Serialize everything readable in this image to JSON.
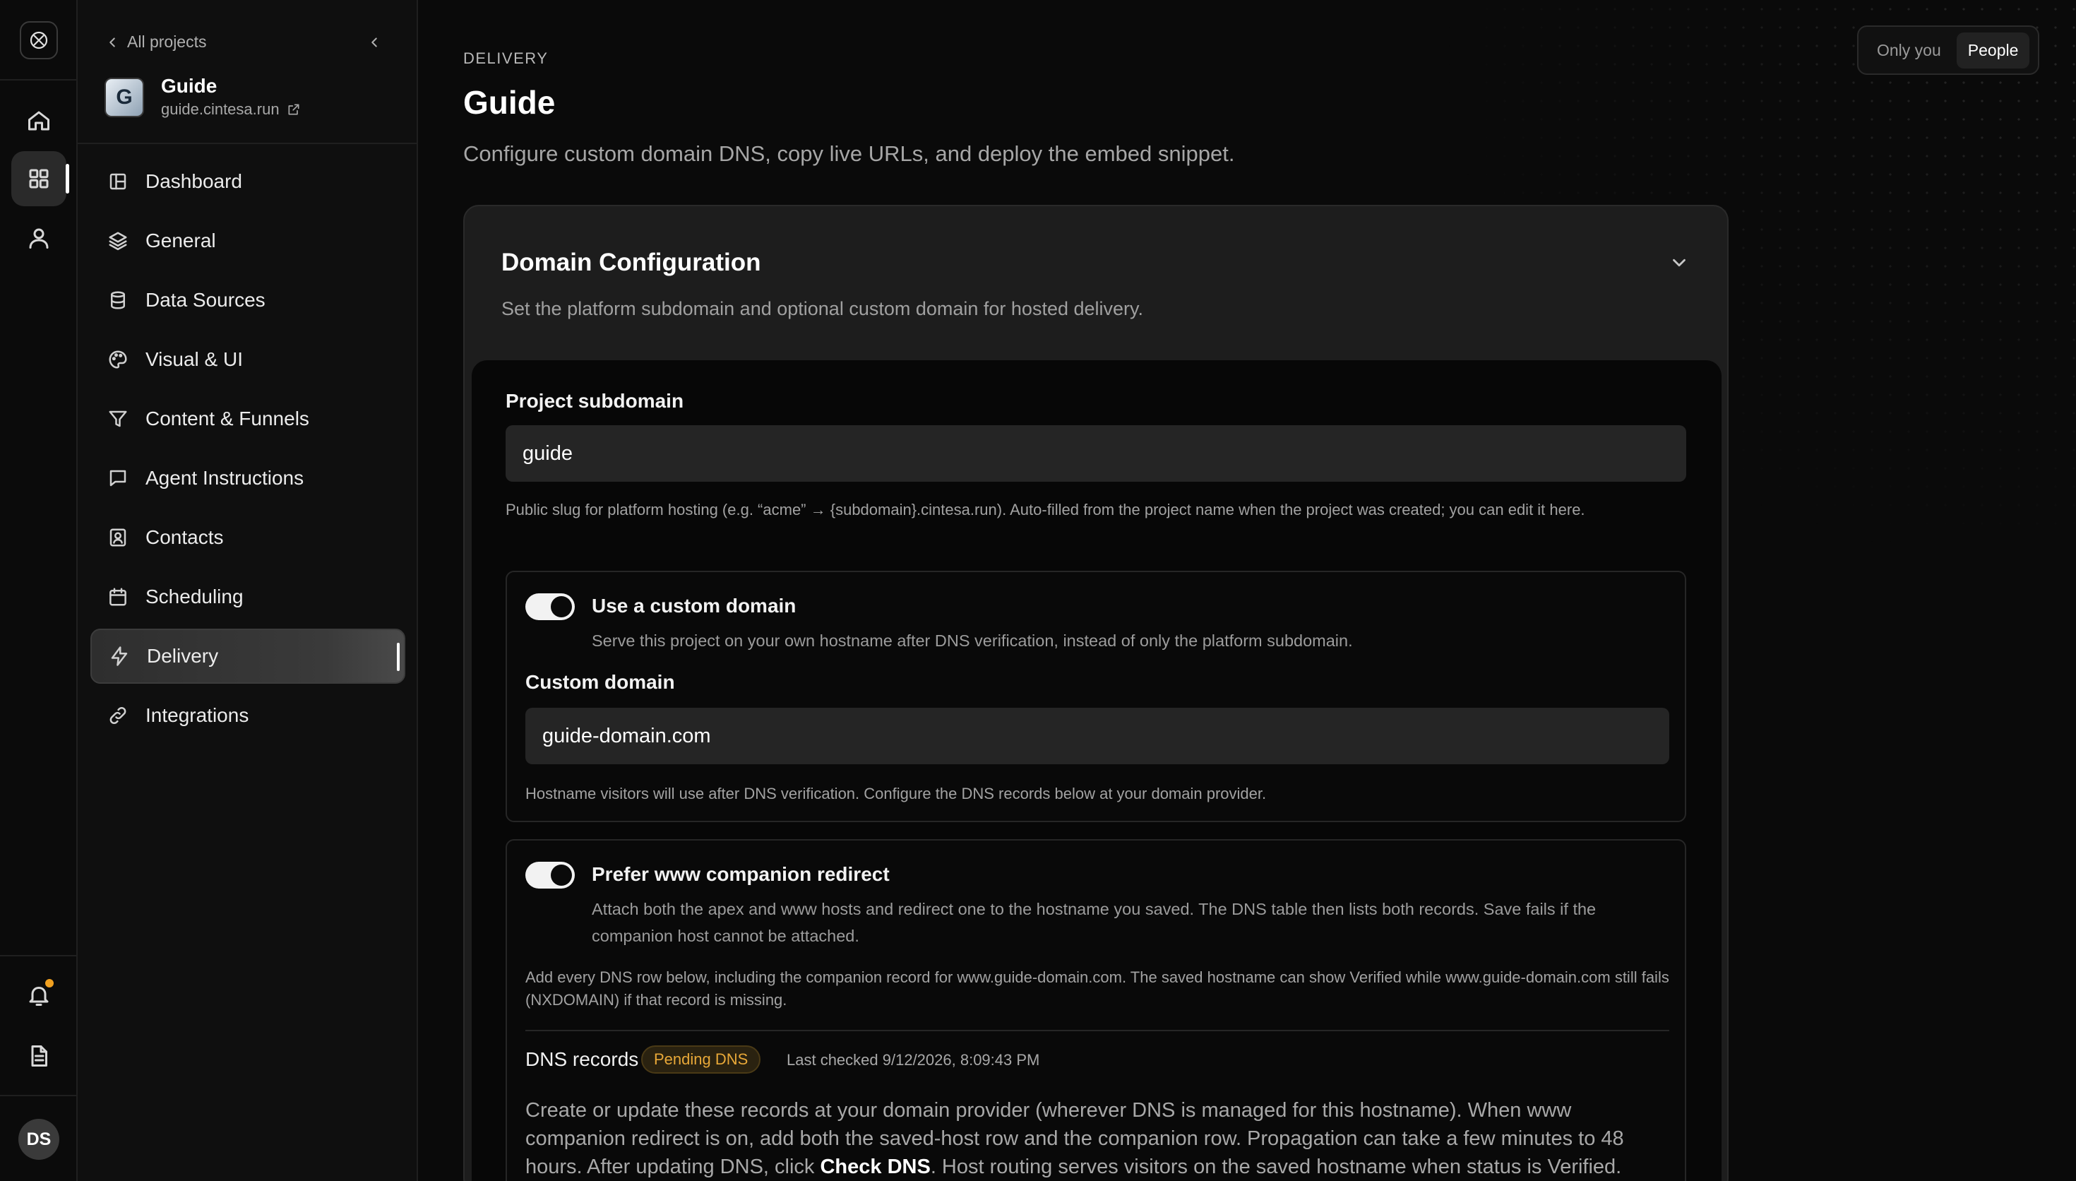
{
  "rail": {
    "items": [
      "home",
      "projects",
      "account"
    ],
    "bottom": [
      "notifications",
      "docs"
    ],
    "avatar_initials": "DS"
  },
  "sidebar": {
    "back_label": "All projects",
    "project_name": "Guide",
    "project_domain": "guide.cintesa.run",
    "items": [
      {
        "label": "Dashboard",
        "icon": "dashboard-icon"
      },
      {
        "label": "General",
        "icon": "layers-icon"
      },
      {
        "label": "Data Sources",
        "icon": "database-icon"
      },
      {
        "label": "Visual & UI",
        "icon": "palette-icon"
      },
      {
        "label": "Content & Funnels",
        "icon": "funnel-icon"
      },
      {
        "label": "Agent Instructions",
        "icon": "chat-icon"
      },
      {
        "label": "Contacts",
        "icon": "contact-icon"
      },
      {
        "label": "Scheduling",
        "icon": "calendar-icon"
      },
      {
        "label": "Delivery",
        "icon": "bolt-icon",
        "active": true
      },
      {
        "label": "Integrations",
        "icon": "link-icon"
      }
    ]
  },
  "header": {
    "eyebrow": "DELIVERY",
    "title": "Guide",
    "subtitle": "Configure custom domain DNS, copy live URLs, and deploy the embed snippet."
  },
  "visibility": {
    "options": [
      "Only you",
      "People"
    ],
    "selected": "People"
  },
  "domain_card": {
    "title": "Domain Configuration",
    "subtitle": "Set the platform subdomain and optional custom domain for hosted delivery.",
    "subdomain": {
      "label": "Project subdomain",
      "value": "guide",
      "help": "Public slug for platform hosting (e.g. “acme” → {subdomain}.cintesa.run). Auto-filled from the project name when the project was created; you can edit it here."
    },
    "custom_domain": {
      "toggle_label": "Use a custom domain",
      "toggle_on": true,
      "toggle_desc": "Serve this project on your own hostname after DNS verification, instead of only the platform subdomain.",
      "label": "Custom domain",
      "value": "guide-domain.com",
      "help": "Hostname visitors will use after DNS verification. Configure the DNS records below at your domain provider."
    },
    "www_redirect": {
      "toggle_label": "Prefer www companion redirect",
      "toggle_on": true,
      "toggle_desc": "Attach both the apex and www hosts and redirect one to the hostname you saved. The DNS table then lists both records. Save fails if the companion host cannot be attached.",
      "note": "Add every DNS row below, including the companion record for www.guide-domain.com. The saved hostname can show Verified while www.guide-domain.com still fails (NXDOMAIN) if that record is missing."
    },
    "dns": {
      "title": "DNS records",
      "status": "Pending DNS",
      "last_checked": "Last checked 9/12/2026, 8:09:43 PM",
      "desc_before": "Create or update these records at your domain provider (wherever DNS is managed for this hostname). When www companion redirect is on, add both the saved-host row and the companion row. Propagation can take a few minutes to 48 hours. After updating DNS, click ",
      "desc_action": "Check DNS",
      "desc_after": ". Host routing serves visitors on the saved hostname when status is Verified."
    }
  },
  "colors": {
    "background": "#0a0a0a",
    "card": "#1d1d1d",
    "badge_text": "#e8a838",
    "notification_dot": "#f0a020"
  }
}
